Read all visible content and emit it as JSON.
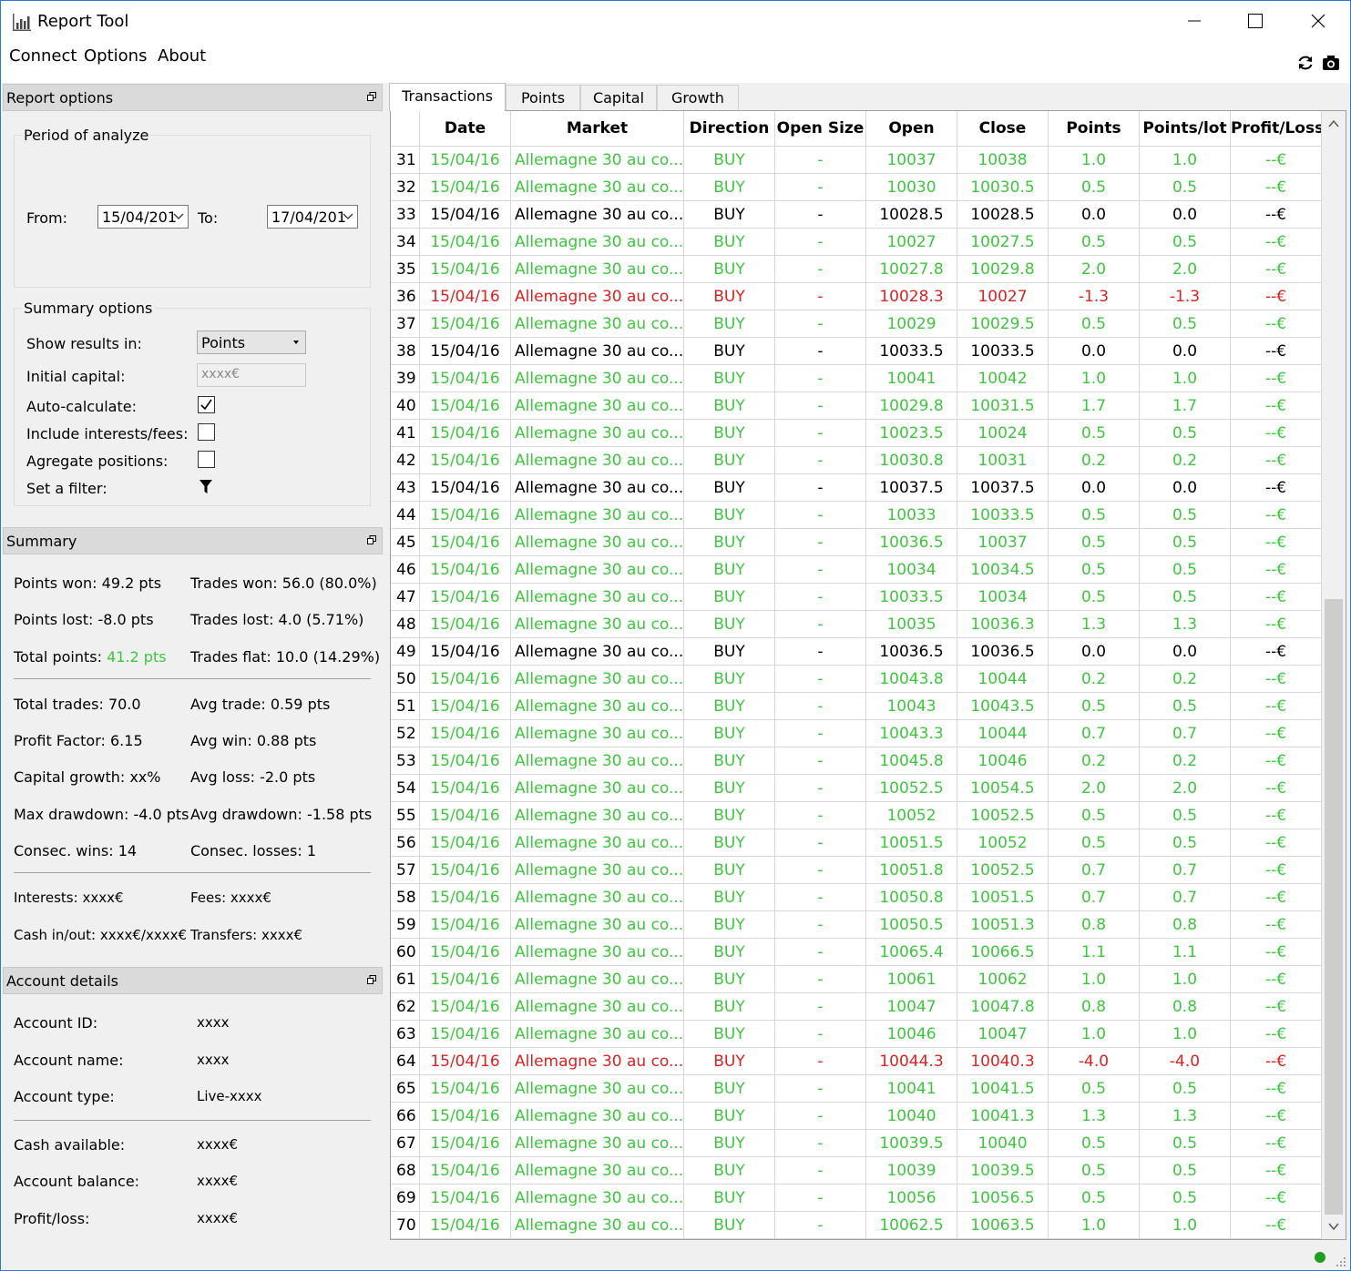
{
  "window": {
    "title": "Report Tool"
  },
  "menu": [
    "Connect",
    "Options",
    "About"
  ],
  "report_options": {
    "header": "Report options",
    "period": {
      "title": "Period of analyze",
      "from_label": "From:",
      "from_value": "15/04/201",
      "to_label": "To:",
      "to_value": "17/04/201"
    },
    "summary_options": {
      "title": "Summary options",
      "show_results_label": "Show results in:",
      "show_results_value": "Points",
      "initial_capital_label": "Initial capital:",
      "initial_capital_placeholder": "xxxx€",
      "auto_calc_label": "Auto-calculate:",
      "auto_calc_checked": true,
      "include_fees_label": "Include interests/fees:",
      "include_fees_checked": false,
      "aggregate_label": "Agregate positions:",
      "aggregate_checked": false,
      "filter_label": "Set a filter:"
    }
  },
  "summary": {
    "header": "Summary",
    "points_won": "Points won: 49.2 pts",
    "trades_won": "Trades won: 56.0 (80.0%)",
    "points_lost": "Points lost: -8.0 pts",
    "trades_lost": "Trades lost: 4.0 (5.71%)",
    "total_points_label": "Total points: ",
    "total_points_value": "41.2 pts",
    "trades_flat": "Trades flat: 10.0 (14.29%)",
    "total_trades": "Total trades: 70.0",
    "avg_trade": "Avg trade: 0.59 pts",
    "profit_factor": "Profit Factor: 6.15",
    "avg_win": "Avg win: 0.88 pts",
    "capital_growth": "Capital growth: xx%",
    "avg_loss": "Avg loss: -2.0 pts",
    "max_drawdown": "Max drawdown: -4.0 pts",
    "avg_drawdown": "Avg drawdown: -1.58 pts",
    "consec_wins": "Consec. wins: 14",
    "consec_losses": "Consec. losses: 1",
    "interests": "Interests: xxxx€",
    "fees": "Fees: xxxx€",
    "cash_inout": "Cash in/out: xxxx€/xxxx€",
    "transfers": "Transfers: xxxx€"
  },
  "account": {
    "header": "Account details",
    "rows": [
      {
        "label": "Account ID:",
        "value": "xxxx"
      },
      {
        "label": "Account name:",
        "value": "xxxx"
      },
      {
        "label": "Account type:",
        "value": "Live-xxxx"
      },
      {
        "label": "Cash available:",
        "value": "xxxx€"
      },
      {
        "label": "Account balance:",
        "value": "xxxx€"
      },
      {
        "label": "Profit/loss:",
        "value": "xxxx€"
      }
    ]
  },
  "tabs": [
    "Transactions",
    "Points",
    "Capital",
    "Growth"
  ],
  "active_tab": 0,
  "table": {
    "columns": [
      "Date",
      "Market",
      "Direction",
      "Open Size",
      "Open",
      "Close",
      "Points",
      "Points/lot",
      "Profit/Loss"
    ],
    "colors": {
      "win": "#3cc83c",
      "loss": "#e02020",
      "flat": "#000000"
    },
    "rows": [
      [
        "31",
        "15/04/16",
        "Allemagne 30 au co...",
        "BUY",
        "-",
        "10037",
        "10038",
        "1.0",
        "1.0",
        "--€"
      ],
      [
        "32",
        "15/04/16",
        "Allemagne 30 au co...",
        "BUY",
        "-",
        "10030",
        "10030.5",
        "0.5",
        "0.5",
        "--€"
      ],
      [
        "33",
        "15/04/16",
        "Allemagne 30 au co...",
        "BUY",
        "-",
        "10028.5",
        "10028.5",
        "0.0",
        "0.0",
        "--€"
      ],
      [
        "34",
        "15/04/16",
        "Allemagne 30 au co...",
        "BUY",
        "-",
        "10027",
        "10027.5",
        "0.5",
        "0.5",
        "--€"
      ],
      [
        "35",
        "15/04/16",
        "Allemagne 30 au co...",
        "BUY",
        "-",
        "10027.8",
        "10029.8",
        "2.0",
        "2.0",
        "--€"
      ],
      [
        "36",
        "15/04/16",
        "Allemagne 30 au co...",
        "BUY",
        "-",
        "10028.3",
        "10027",
        "-1.3",
        "-1.3",
        "--€"
      ],
      [
        "37",
        "15/04/16",
        "Allemagne 30 au co...",
        "BUY",
        "-",
        "10029",
        "10029.5",
        "0.5",
        "0.5",
        "--€"
      ],
      [
        "38",
        "15/04/16",
        "Allemagne 30 au co...",
        "BUY",
        "-",
        "10033.5",
        "10033.5",
        "0.0",
        "0.0",
        "--€"
      ],
      [
        "39",
        "15/04/16",
        "Allemagne 30 au co...",
        "BUY",
        "-",
        "10041",
        "10042",
        "1.0",
        "1.0",
        "--€"
      ],
      [
        "40",
        "15/04/16",
        "Allemagne 30 au co...",
        "BUY",
        "-",
        "10029.8",
        "10031.5",
        "1.7",
        "1.7",
        "--€"
      ],
      [
        "41",
        "15/04/16",
        "Allemagne 30 au co...",
        "BUY",
        "-",
        "10023.5",
        "10024",
        "0.5",
        "0.5",
        "--€"
      ],
      [
        "42",
        "15/04/16",
        "Allemagne 30 au co...",
        "BUY",
        "-",
        "10030.8",
        "10031",
        "0.2",
        "0.2",
        "--€"
      ],
      [
        "43",
        "15/04/16",
        "Allemagne 30 au co...",
        "BUY",
        "-",
        "10037.5",
        "10037.5",
        "0.0",
        "0.0",
        "--€"
      ],
      [
        "44",
        "15/04/16",
        "Allemagne 30 au co...",
        "BUY",
        "-",
        "10033",
        "10033.5",
        "0.5",
        "0.5",
        "--€"
      ],
      [
        "45",
        "15/04/16",
        "Allemagne 30 au co...",
        "BUY",
        "-",
        "10036.5",
        "10037",
        "0.5",
        "0.5",
        "--€"
      ],
      [
        "46",
        "15/04/16",
        "Allemagne 30 au co...",
        "BUY",
        "-",
        "10034",
        "10034.5",
        "0.5",
        "0.5",
        "--€"
      ],
      [
        "47",
        "15/04/16",
        "Allemagne 30 au co...",
        "BUY",
        "-",
        "10033.5",
        "10034",
        "0.5",
        "0.5",
        "--€"
      ],
      [
        "48",
        "15/04/16",
        "Allemagne 30 au co...",
        "BUY",
        "-",
        "10035",
        "10036.3",
        "1.3",
        "1.3",
        "--€"
      ],
      [
        "49",
        "15/04/16",
        "Allemagne 30 au co...",
        "BUY",
        "-",
        "10036.5",
        "10036.5",
        "0.0",
        "0.0",
        "--€"
      ],
      [
        "50",
        "15/04/16",
        "Allemagne 30 au co...",
        "BUY",
        "-",
        "10043.8",
        "10044",
        "0.2",
        "0.2",
        "--€"
      ],
      [
        "51",
        "15/04/16",
        "Allemagne 30 au co...",
        "BUY",
        "-",
        "10043",
        "10043.5",
        "0.5",
        "0.5",
        "--€"
      ],
      [
        "52",
        "15/04/16",
        "Allemagne 30 au co...",
        "BUY",
        "-",
        "10043.3",
        "10044",
        "0.7",
        "0.7",
        "--€"
      ],
      [
        "53",
        "15/04/16",
        "Allemagne 30 au co...",
        "BUY",
        "-",
        "10045.8",
        "10046",
        "0.2",
        "0.2",
        "--€"
      ],
      [
        "54",
        "15/04/16",
        "Allemagne 30 au co...",
        "BUY",
        "-",
        "10052.5",
        "10054.5",
        "2.0",
        "2.0",
        "--€"
      ],
      [
        "55",
        "15/04/16",
        "Allemagne 30 au co...",
        "BUY",
        "-",
        "10052",
        "10052.5",
        "0.5",
        "0.5",
        "--€"
      ],
      [
        "56",
        "15/04/16",
        "Allemagne 30 au co...",
        "BUY",
        "-",
        "10051.5",
        "10052",
        "0.5",
        "0.5",
        "--€"
      ],
      [
        "57",
        "15/04/16",
        "Allemagne 30 au co...",
        "BUY",
        "-",
        "10051.8",
        "10052.5",
        "0.7",
        "0.7",
        "--€"
      ],
      [
        "58",
        "15/04/16",
        "Allemagne 30 au co...",
        "BUY",
        "-",
        "10050.8",
        "10051.5",
        "0.7",
        "0.7",
        "--€"
      ],
      [
        "59",
        "15/04/16",
        "Allemagne 30 au co...",
        "BUY",
        "-",
        "10050.5",
        "10051.3",
        "0.8",
        "0.8",
        "--€"
      ],
      [
        "60",
        "15/04/16",
        "Allemagne 30 au co...",
        "BUY",
        "-",
        "10065.4",
        "10066.5",
        "1.1",
        "1.1",
        "--€"
      ],
      [
        "61",
        "15/04/16",
        "Allemagne 30 au co...",
        "BUY",
        "-",
        "10061",
        "10062",
        "1.0",
        "1.0",
        "--€"
      ],
      [
        "62",
        "15/04/16",
        "Allemagne 30 au co...",
        "BUY",
        "-",
        "10047",
        "10047.8",
        "0.8",
        "0.8",
        "--€"
      ],
      [
        "63",
        "15/04/16",
        "Allemagne 30 au co...",
        "BUY",
        "-",
        "10046",
        "10047",
        "1.0",
        "1.0",
        "--€"
      ],
      [
        "64",
        "15/04/16",
        "Allemagne 30 au co...",
        "BUY",
        "-",
        "10044.3",
        "10040.3",
        "-4.0",
        "-4.0",
        "--€"
      ],
      [
        "65",
        "15/04/16",
        "Allemagne 30 au co...",
        "BUY",
        "-",
        "10041",
        "10041.5",
        "0.5",
        "0.5",
        "--€"
      ],
      [
        "66",
        "15/04/16",
        "Allemagne 30 au co...",
        "BUY",
        "-",
        "10040",
        "10041.3",
        "1.3",
        "1.3",
        "--€"
      ],
      [
        "67",
        "15/04/16",
        "Allemagne 30 au co...",
        "BUY",
        "-",
        "10039.5",
        "10040",
        "0.5",
        "0.5",
        "--€"
      ],
      [
        "68",
        "15/04/16",
        "Allemagne 30 au co...",
        "BUY",
        "-",
        "10039",
        "10039.5",
        "0.5",
        "0.5",
        "--€"
      ],
      [
        "69",
        "15/04/16",
        "Allemagne 30 au co...",
        "BUY",
        "-",
        "10056",
        "10056.5",
        "0.5",
        "0.5",
        "--€"
      ],
      [
        "70",
        "15/04/16",
        "Allemagne 30 au co...",
        "BUY",
        "-",
        "10062.5",
        "10063.5",
        "1.0",
        "1.0",
        "--€"
      ]
    ]
  },
  "scroll": {
    "position": 0.43
  }
}
